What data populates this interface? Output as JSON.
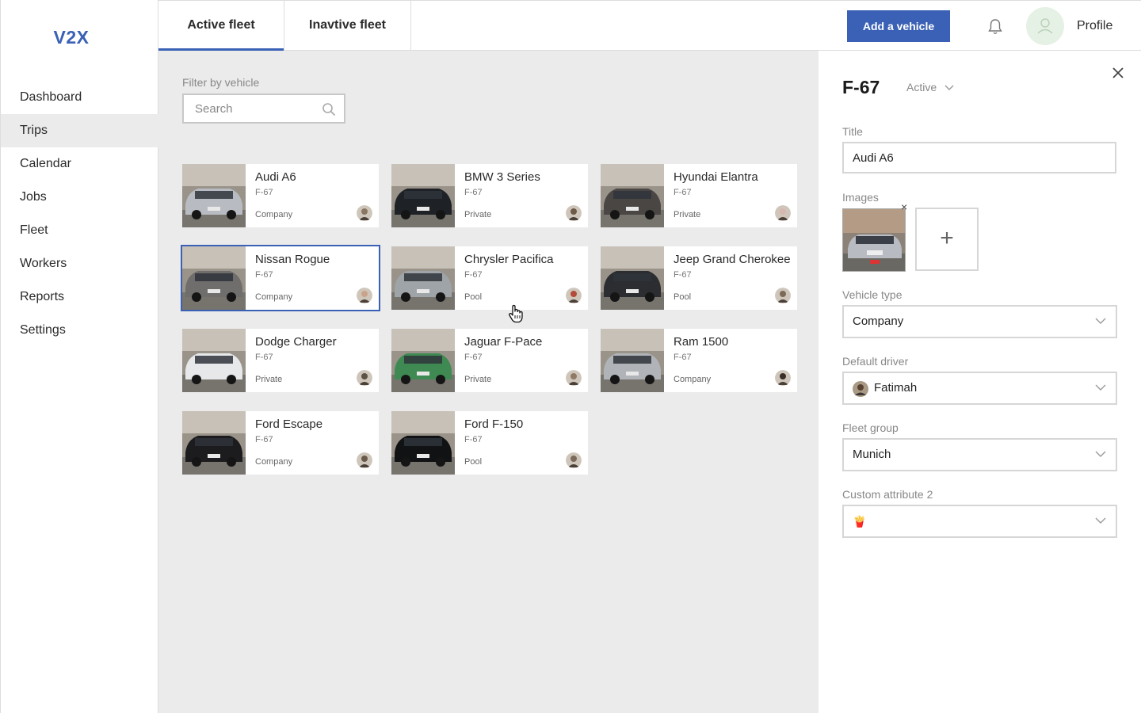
{
  "app": {
    "logo": "V2X"
  },
  "sidebar": {
    "items": [
      {
        "label": "Dashboard",
        "active": false
      },
      {
        "label": "Trips",
        "active": true
      },
      {
        "label": "Calendar",
        "active": false
      },
      {
        "label": "Jobs",
        "active": false
      },
      {
        "label": "Fleet",
        "active": false
      },
      {
        "label": "Workers",
        "active": false
      },
      {
        "label": "Reports",
        "active": false
      },
      {
        "label": "Settings",
        "active": false
      }
    ]
  },
  "topbar": {
    "tabs": [
      {
        "label": "Active fleet",
        "active": true
      },
      {
        "label": "Inavtive fleet",
        "active": false
      }
    ],
    "add_button": "Add a vehicle",
    "profile_label": "Profile",
    "bell_icon": "bell-icon",
    "accent": "#3a61b5"
  },
  "filter": {
    "label": "Filter by vehicle",
    "placeholder": "Search",
    "value": ""
  },
  "vehicles": [
    {
      "title": "Audi A6",
      "code": "F-67",
      "type": "Company",
      "car_color": "#b8bcc2",
      "selected": false
    },
    {
      "title": "BMW 3 Series",
      "code": "F-67",
      "type": "Private",
      "car_color": "#1e2226",
      "selected": false
    },
    {
      "title": "Hyundai Elantra",
      "code": "F-67",
      "type": "Private",
      "car_color": "#4a4644",
      "selected": false
    },
    {
      "title": "Nissan Rogue",
      "code": "F-67",
      "type": "Company",
      "car_color": "#6f6e6c",
      "selected": true
    },
    {
      "title": "Chrysler Pacifica",
      "code": "F-67",
      "type": "Pool",
      "car_color": "#9fa4a8",
      "selected": false
    },
    {
      "title": "Jeep Grand Cherokee",
      "code": "F-67",
      "type": "Pool",
      "car_color": "#2b2d30",
      "selected": false
    },
    {
      "title": "Dodge Charger",
      "code": "F-67",
      "type": "Private",
      "car_color": "#e6e8ea",
      "selected": false
    },
    {
      "title": "Jaguar F-Pace",
      "code": "F-67",
      "type": "Private",
      "car_color": "#3f8a52",
      "selected": false
    },
    {
      "title": "Ram 1500",
      "code": "F-67",
      "type": "Company",
      "car_color": "#b0b4b8",
      "selected": false
    },
    {
      "title": "Ford Escape",
      "code": "F-67",
      "type": "Company",
      "car_color": "#1c1c1e",
      "selected": false
    },
    {
      "title": "Ford F-150",
      "code": "F-67",
      "type": "Pool",
      "car_color": "#111214",
      "selected": false
    }
  ],
  "panel": {
    "title": "F-67",
    "status": "Active",
    "fields": {
      "title_label": "Title",
      "title_value": "Audi A6",
      "images_label": "Images",
      "add_image_symbol": "+",
      "remove_image_symbol": "×",
      "vehicle_type_label": "Vehicle type",
      "vehicle_type_value": "Company",
      "default_driver_label": "Default driver",
      "default_driver_value": "Fatimah",
      "fleet_group_label": "Fleet group",
      "fleet_group_value": "Munich",
      "custom_attribute_label": "Custom attribute 2",
      "custom_attribute_value": "🍟"
    }
  }
}
